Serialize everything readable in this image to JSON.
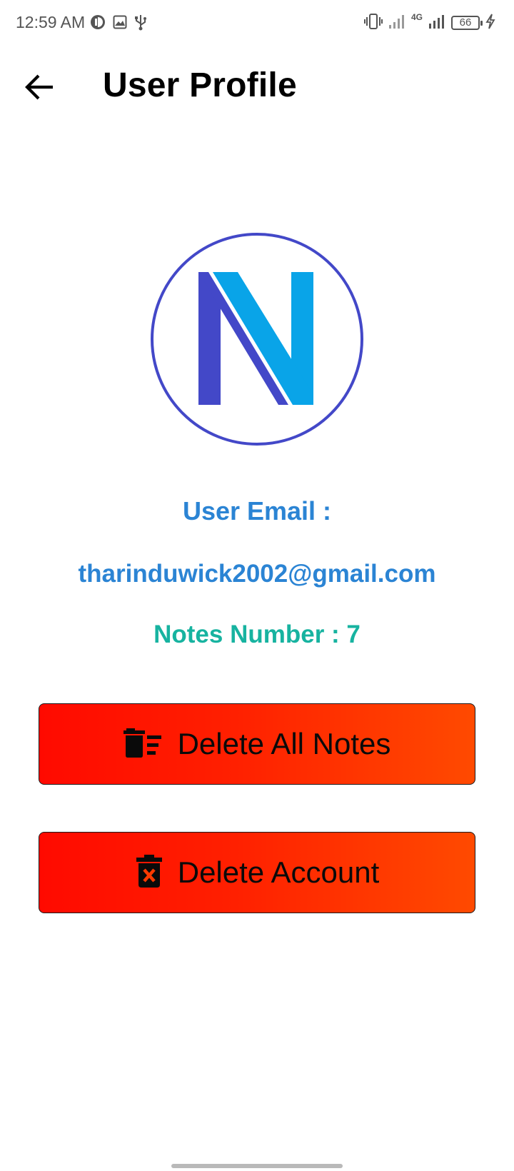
{
  "status_bar": {
    "time": "12:59 AM",
    "network": "4G",
    "battery": "66",
    "icons": [
      "vpn-icon",
      "gallery-icon",
      "usb-icon",
      "vibrate-icon",
      "signal-icon",
      "signal-4g-icon",
      "battery-icon",
      "charging-icon"
    ]
  },
  "app_bar": {
    "title": "User Profile",
    "back_icon": "arrow-left-icon"
  },
  "profile": {
    "avatar_letter": "N",
    "email_label": "User Email :",
    "email": "tharinduwick2002@gmail.com",
    "notes_count_text": "Notes Number : 7"
  },
  "actions": {
    "delete_all_notes": "Delete All Notes",
    "delete_account": "Delete Account"
  },
  "colors": {
    "accent_blue": "#2b84d4",
    "accent_teal": "#17b3a0",
    "logo_indigo": "#4348c8",
    "logo_sky": "#09a4e8",
    "button_red": "#ff0a00",
    "button_orange": "#ff4a00"
  }
}
